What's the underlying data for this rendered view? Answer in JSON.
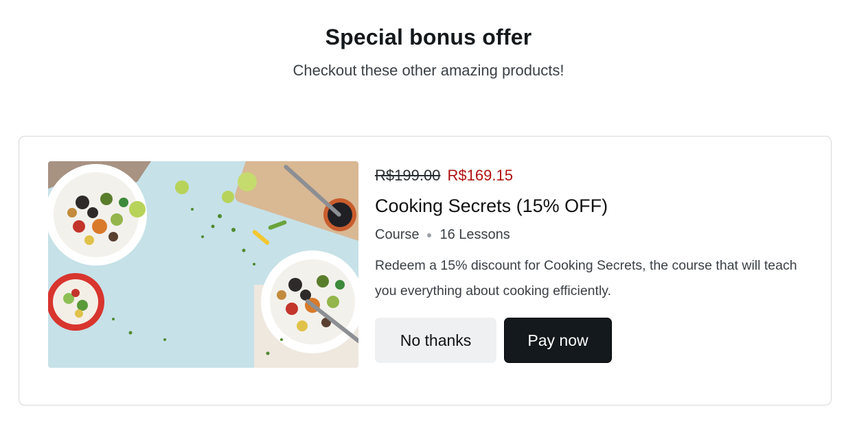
{
  "header": {
    "title": "Special bonus offer",
    "subtitle": "Checkout these other amazing products!"
  },
  "offer": {
    "image_alt": "Food bowls on a light blue table",
    "old_price": "R$199.00",
    "new_price": "R$169.15",
    "name": "Cooking Secrets (15% OFF)",
    "type": "Course",
    "lessons": "16 Lessons",
    "description": "Redeem a 15% discount for Cooking Secrets, the course that will teach you everything about cooking efficiently.",
    "decline_label": "No thanks",
    "accept_label": "Pay now"
  },
  "colors": {
    "accent_price": "#b0100f",
    "primary_button": "#13191d",
    "secondary_button": "#eef0f2",
    "border": "#d6d8db"
  }
}
